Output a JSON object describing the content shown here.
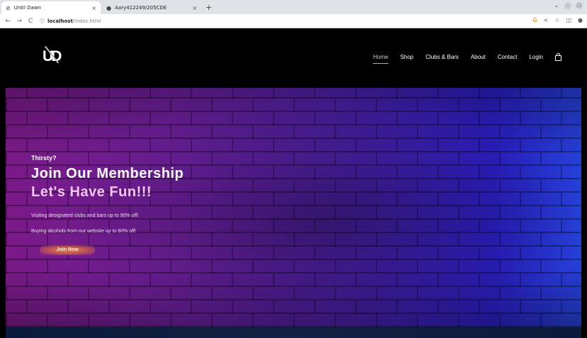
{
  "browser": {
    "tabs": [
      {
        "title": "Until Dawn",
        "icon": "globe-icon",
        "active": true
      },
      {
        "title": "Aary412249/205CDE",
        "icon": "github-icon",
        "active": false
      }
    ],
    "new_tab": "+",
    "url": {
      "host": "localhost",
      "path": "/index.html"
    }
  },
  "site": {
    "logo_text": "UD",
    "nav": [
      {
        "label": "Home",
        "current": true
      },
      {
        "label": "Shop"
      },
      {
        "label": "Clubs & Bars"
      },
      {
        "label": "About"
      },
      {
        "label": "Contact"
      },
      {
        "label": "Login"
      }
    ]
  },
  "hero": {
    "eyebrow": "Thirsty?",
    "headline": "Join Our Membership",
    "headline2": "Let's Have Fun!!!",
    "perk1": "Visiting designated clubs and bars up to 90% off!",
    "perk2": "Buying alcohols from our website up to 80% off!",
    "cta": "Join Now"
  },
  "colors": {
    "header_bg": "#000000",
    "hero_left": "#7a1a87",
    "hero_right": "#2540d8"
  }
}
